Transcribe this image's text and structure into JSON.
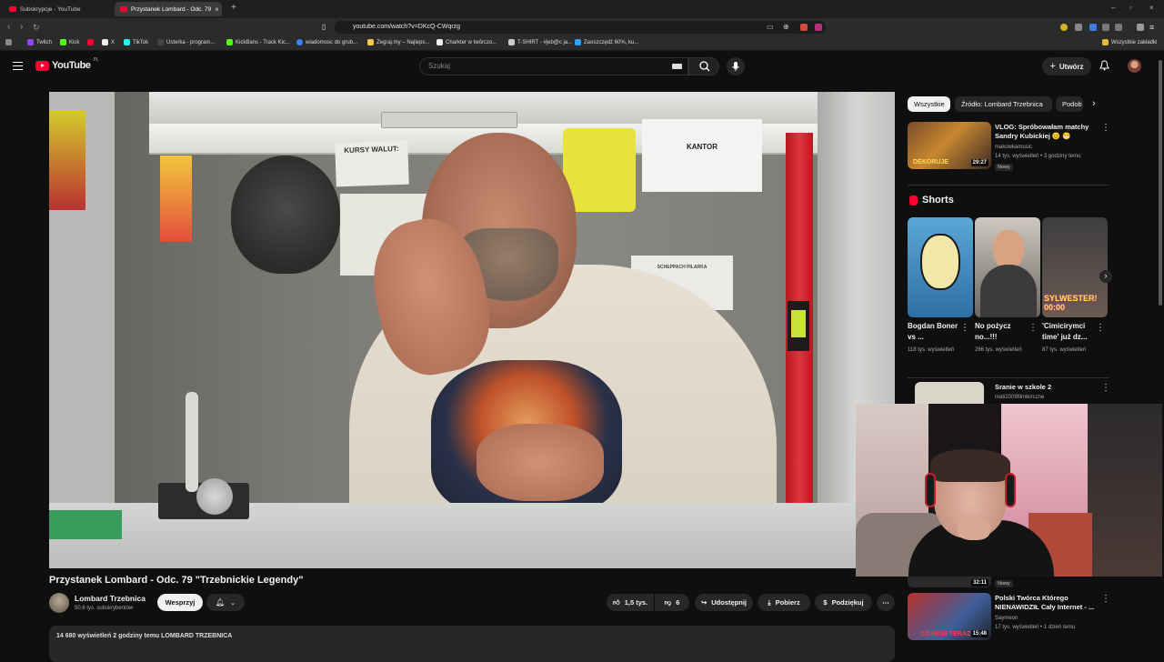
{
  "browser": {
    "tabs": [
      {
        "label": "Subskrypcje - YouTube"
      },
      {
        "label": "Przystanek Lombard - Odc. 79"
      }
    ],
    "url": "youtube.com/watch?v=DKcQ-CWqrzg",
    "bookmarks": [
      "Twitch",
      "Kick",
      "X",
      "TikTok",
      "Usterka - program...",
      "KickBans - Track Kic...",
      "wiadomosc do grub...",
      "Zegraj.my – Najleps...",
      "Charkter w twórczo...",
      "T-SHIRT - #jeb@c ja...",
      "Zaoszczędź 60%, ku..."
    ],
    "bookmarks_folder": "Wszystkie zakładki"
  },
  "header": {
    "logo": "YouTube",
    "country": "PL",
    "search_placeholder": "Szukaj",
    "create_label": "Utwórz"
  },
  "video": {
    "title": "Przystanek Lombard - Odc. 79 \"Trzebnickie Legendy\"",
    "channel": "Lombard Trzebnica",
    "subscribers": "50,6 tys. subskrybentów",
    "support_label": "Wesprzyj",
    "likes": "1,5 tys.",
    "dislikes": "6",
    "share_label": "Udostępnij",
    "download_label": "Pobierz",
    "thanks_label": "Podziękuj",
    "more_label": "⋯",
    "description_peek": "14 680 wyświetleń  2 godziny temu  LOMBARD TRZEBNICA",
    "scene_text": {
      "kursy": "KURSY WALUT:",
      "kantor": "KANTOR",
      "sign": "SCHEPPACH PILARKA"
    }
  },
  "sidebar": {
    "chips": [
      {
        "label": "Wszystkie",
        "selected": true
      },
      {
        "label": "Źródło: Lombard Trzebnica",
        "selected": false
      },
      {
        "label": "Podob",
        "selected": false
      }
    ],
    "rec1": {
      "title": "VLOG: Spróbowałam matchy Sandry Kubickiej 😊 😁",
      "channel": "makowkamusic",
      "meta": "14 tys. wyświetleń • 3 godziny temu",
      "badge": "Nowy",
      "duration": "29:27",
      "thumb_text": "DEKORUJE"
    },
    "shorts_heading": "Shorts",
    "shorts": [
      {
        "title": "Bogdan Boner vs ...",
        "views": "118 tys. wyświetleń"
      },
      {
        "title": "No pożycz no...!!!",
        "views": "266 tys. wyświetleń"
      },
      {
        "title": "'Cimicirymci time' już dz...",
        "views": "87 tys. wyświetleń",
        "overlay": "SYLWESTER! 00:00"
      }
    ],
    "rec2": {
      "title": "Sranie w szkole 2",
      "channel": "mati2009filmikirczne"
    },
    "rec3": {
      "duration_peek": "32:11",
      "badge": "Nowy"
    },
    "rec4": {
      "title": "Polski Twórca Którego NIENAWIDZIŁ Cały Internet - ...",
      "channel": "Saymeon",
      "meta": "17 tys. wyświetleń • 1 dzień temu",
      "duration": "15:48",
      "thumb_text": "CO ROBI TERAZ"
    }
  },
  "colors": {
    "brand_red": "#ff0033",
    "bg": "#0f0f0f",
    "chip_bg": "#272727"
  }
}
